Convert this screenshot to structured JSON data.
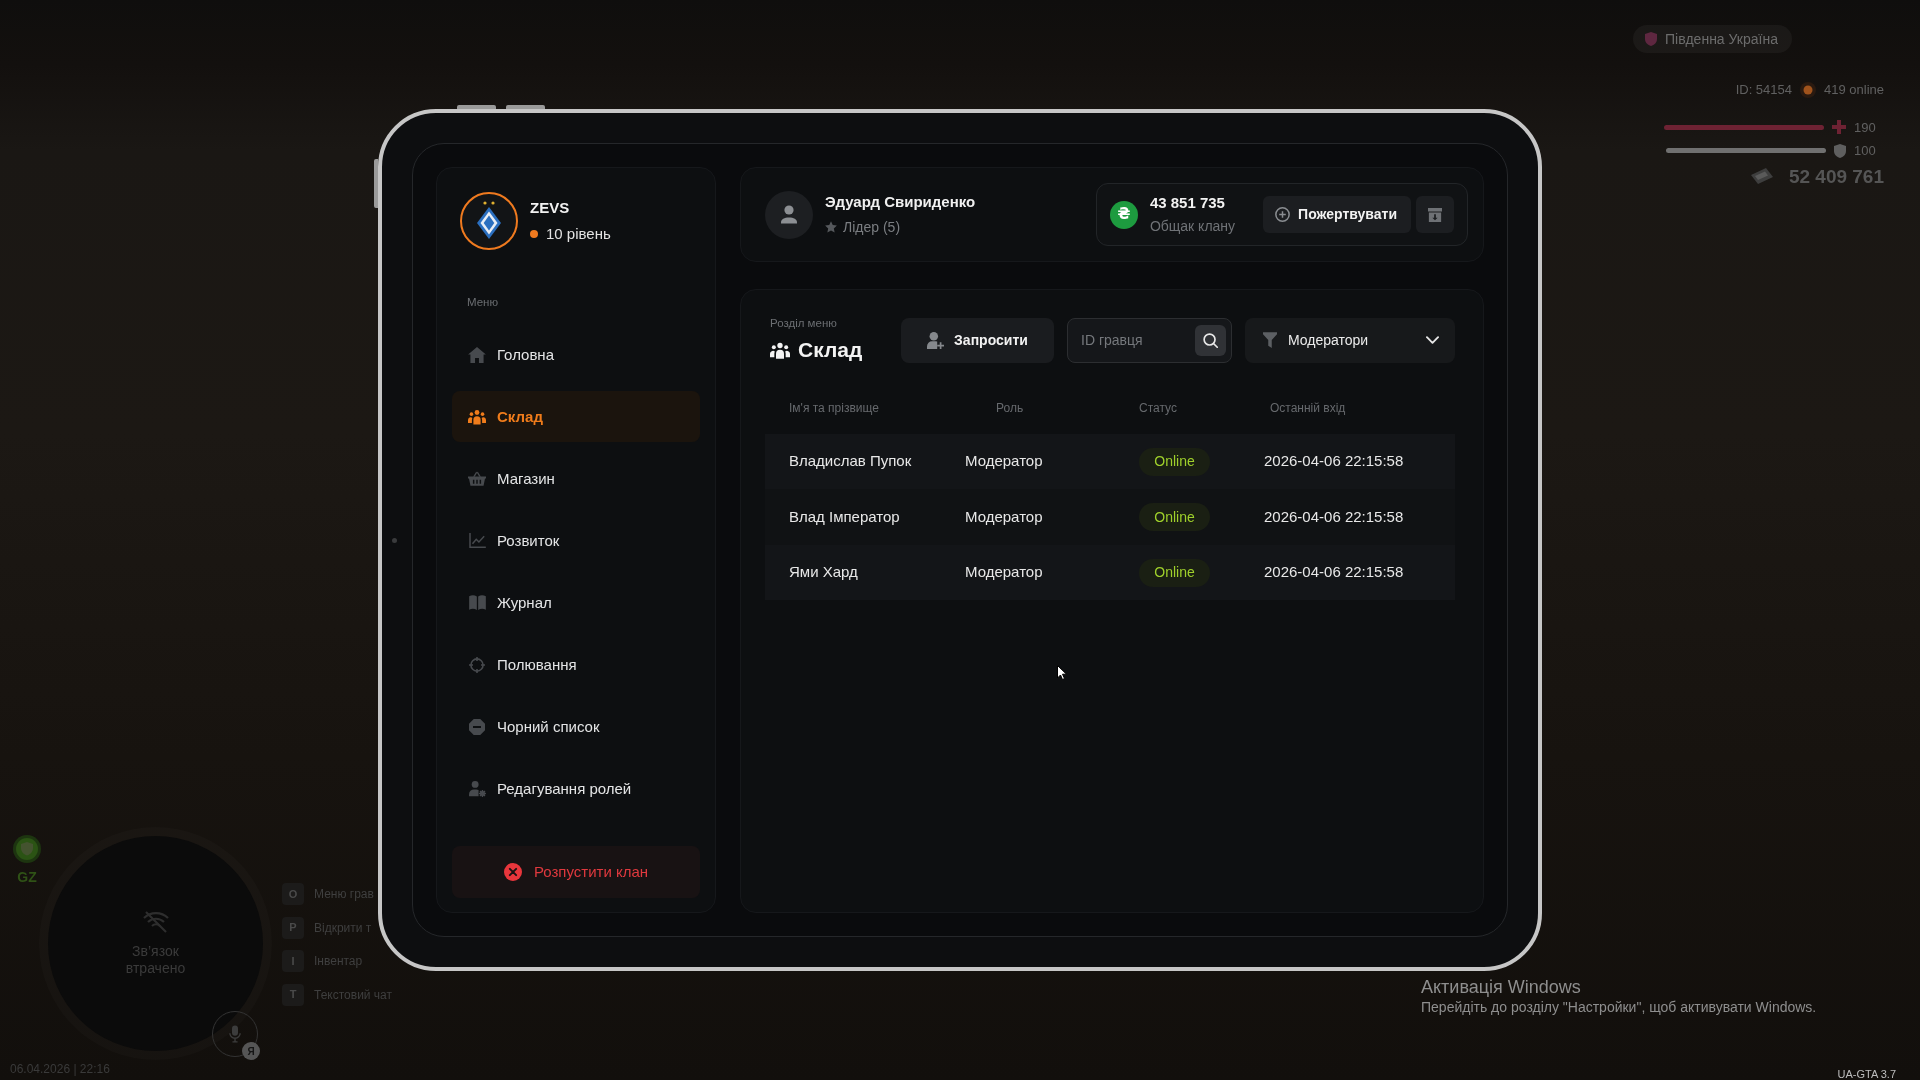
{
  "hud": {
    "server": "Південна Україна",
    "player_id": "ID: 54154",
    "online": "419 online",
    "health": {
      "level": 1,
      "value": "190"
    },
    "armor": {
      "level": 1,
      "value": "100"
    },
    "money": "52 409 761"
  },
  "safe_zone": "GZ",
  "minimap": {
    "message": "Зв’язок втрачено"
  },
  "voice_chat": {
    "badge": "Я"
  },
  "hotkeys": [
    {
      "key": "O",
      "label": "Меню грав"
    },
    {
      "key": "P",
      "label": "Відкрити т"
    },
    {
      "key": "I",
      "label": "Інвентар"
    },
    {
      "key": "T",
      "label": "Текстовий чат"
    }
  ],
  "datetime": "06.04.2026 | 22:16",
  "tablet": {
    "clan": {
      "name": "ZEVS",
      "level": "10 рівень"
    },
    "sidebar": {
      "heading": "Меню",
      "items": [
        {
          "label": "Головна",
          "selected": false
        },
        {
          "label": "Склад",
          "selected": true
        },
        {
          "label": "Магазин",
          "selected": false
        },
        {
          "label": "Розвиток",
          "selected": false
        },
        {
          "label": "Журнал",
          "selected": false
        },
        {
          "label": "Полювання",
          "selected": false
        },
        {
          "label": "Чорний список",
          "selected": false
        },
        {
          "label": "Редагування ролей",
          "selected": false
        }
      ],
      "disband_button": "Розпустити клан"
    },
    "profile": {
      "name": "Эдуард Свириденко",
      "role": "Лідер (5)"
    },
    "treasury": {
      "currency": "₴",
      "amount": "43 851 735",
      "label": "Общак клану",
      "donate_button": "Пожертвувати"
    },
    "section": {
      "caption": "Розділ меню",
      "title": "Склад"
    },
    "invite_button": "Запросити",
    "search": {
      "placeholder": "ID гравця"
    },
    "filter": {
      "value": "Модератори"
    },
    "table": {
      "columns": [
        "Ім'я та прізвище",
        "Роль",
        "Статус",
        "Останній вхід"
      ],
      "rows": [
        {
          "name": "Владислав Пупок",
          "role": "Модератор",
          "status": "Online",
          "last_login": "2026-04-06 22:15:58"
        },
        {
          "name": "Влад Імператор",
          "role": "Модератор",
          "status": "Online",
          "last_login": "2026-04-06 22:15:58"
        },
        {
          "name": "Ями Хард",
          "role": "Модератор",
          "status": "Online",
          "last_login": "2026-04-06 22:15:58"
        }
      ]
    }
  },
  "windows_activation": {
    "title": "Активація Windows",
    "text": "Перейдіть до розділу \"Настройки\", щоб активувати Windows."
  },
  "build": "UA-GTA 3.7"
}
